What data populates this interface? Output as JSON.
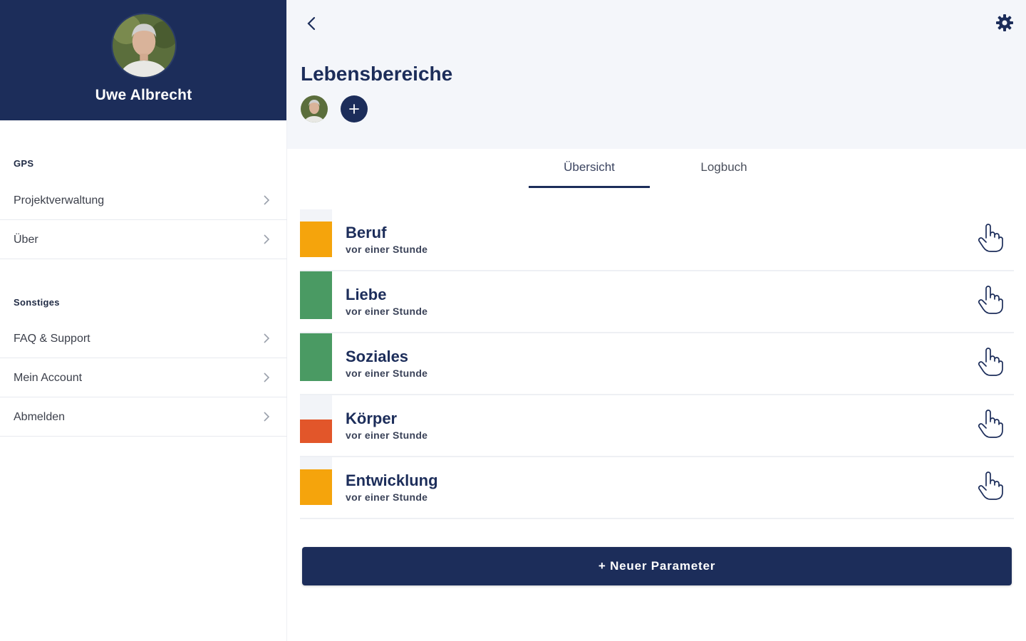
{
  "colors": {
    "brand": "#1c2d5a",
    "level_orange": "#f5a40c",
    "level_green": "#4a9a63",
    "level_red": "#e2562a"
  },
  "sidebar": {
    "user_name": "Uwe Albrecht",
    "sections": [
      {
        "label": "GPS",
        "items": [
          {
            "label": "Projektverwaltung"
          },
          {
            "label": "Über"
          }
        ]
      },
      {
        "label": "Sonstiges",
        "items": [
          {
            "label": "FAQ & Support"
          },
          {
            "label": "Mein Account"
          },
          {
            "label": "Abmelden"
          }
        ]
      }
    ]
  },
  "header": {
    "title": "Lebensbereiche",
    "back_icon": "chevron-left-icon",
    "settings_icon": "gear-icon",
    "add_icon": "plus-icon"
  },
  "tabs": [
    {
      "label": "Übersicht",
      "active": true
    },
    {
      "label": "Logbuch",
      "active": false
    }
  ],
  "areas": [
    {
      "name": "Beruf",
      "time": "vor einer Stunde",
      "level": 0.75,
      "color": "#f5a40c"
    },
    {
      "name": "Liebe",
      "time": "vor einer Stunde",
      "level": 1.0,
      "color": "#4a9a63"
    },
    {
      "name": "Soziales",
      "time": "vor einer Stunde",
      "level": 1.0,
      "color": "#4a9a63"
    },
    {
      "name": "Körper",
      "time": "vor einer Stunde",
      "level": 0.5,
      "color": "#e2562a"
    },
    {
      "name": "Entwicklung",
      "time": "vor einer Stunde",
      "level": 0.75,
      "color": "#f5a40c"
    }
  ],
  "new_param_label": "+ Neuer Parameter"
}
